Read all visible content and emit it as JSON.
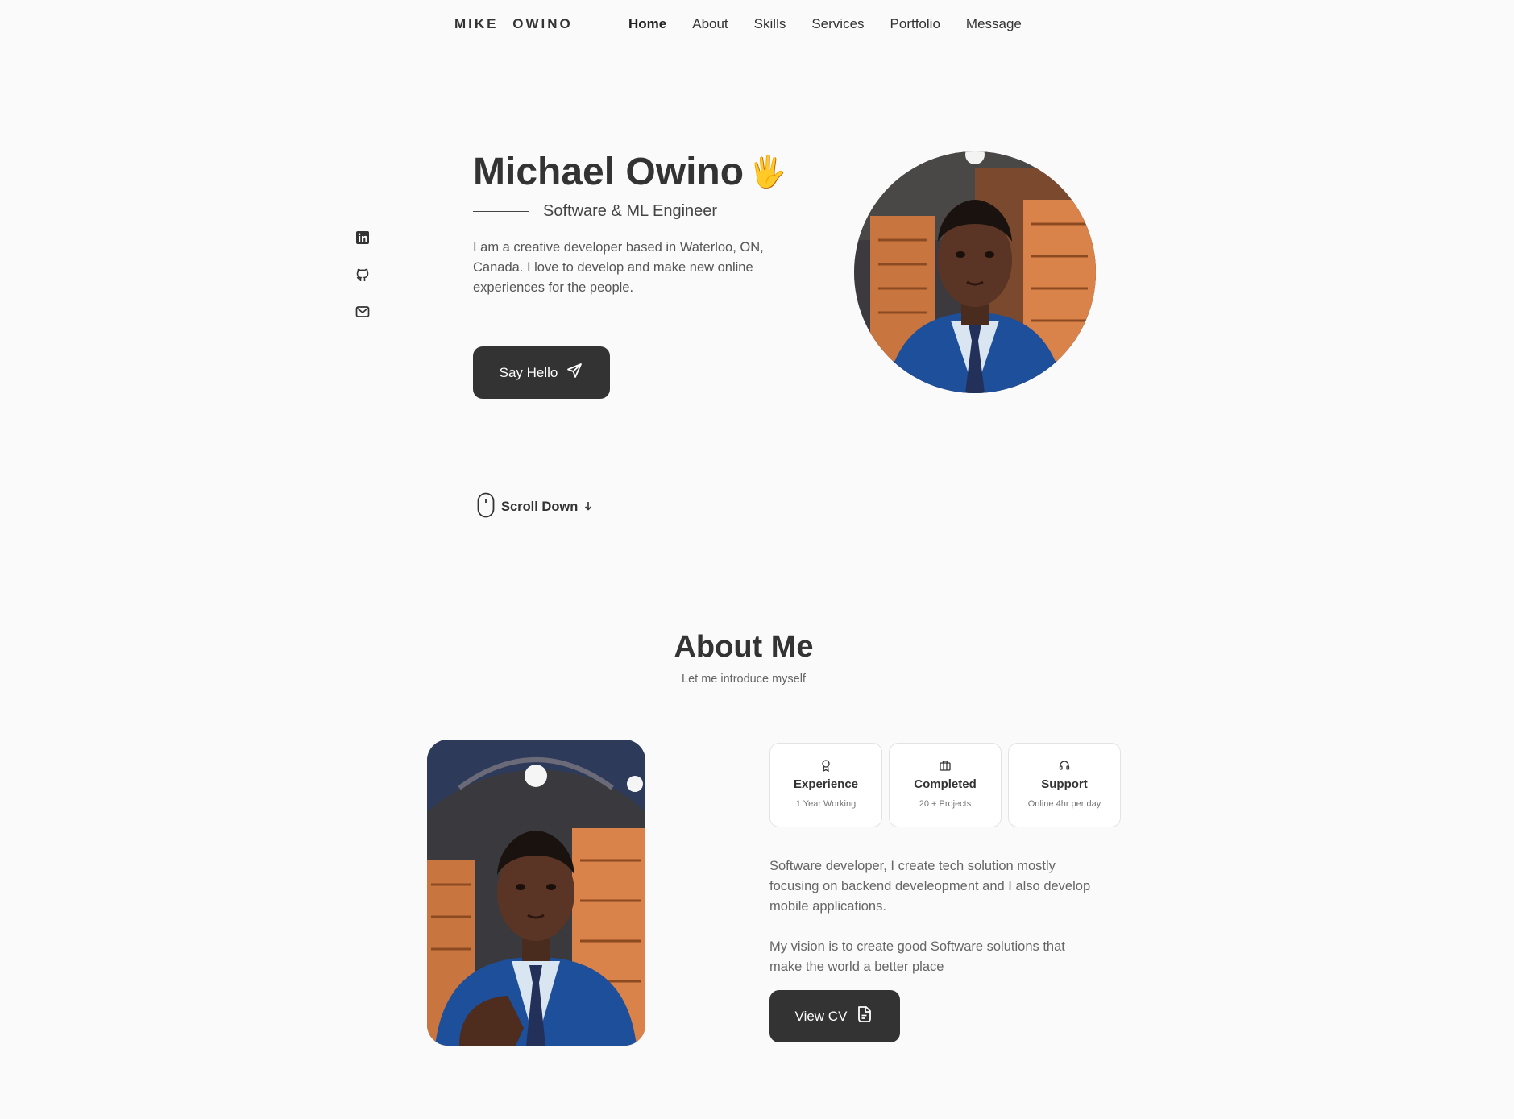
{
  "header": {
    "logo": "MIKE OWINO",
    "nav": [
      "Home",
      "About",
      "Skills",
      "Services",
      "Portfolio",
      "Message"
    ]
  },
  "socials": {
    "icons": [
      "linkedin-icon",
      "github-icon",
      "mail-icon"
    ]
  },
  "hero": {
    "name": "Michael Owino",
    "wave_emoji": "🖐",
    "subtitle": "Software & ML Engineer",
    "description": "I am a creative developer based in Waterloo, ON, Canada. I love to develop and make new online experiences for the people.",
    "button_label": "Say Hello",
    "scroll_label": "Scroll Down"
  },
  "about": {
    "title": "About Me",
    "subtitle": "Let me introduce myself",
    "cards": [
      {
        "title": "Experience",
        "sub": "1 Year Working",
        "icon": "award-icon"
      },
      {
        "title": "Completed",
        "sub": "20 + Projects",
        "icon": "briefcase-icon"
      },
      {
        "title": "Support",
        "sub": "Online 4hr per day",
        "icon": "headset-icon"
      }
    ],
    "paragraph1": "Software developer, I create tech solution mostly focusing on backend develeopment and I also develop mobile applications.",
    "paragraph2": "My vision is to create good Software solutions that make the world a better place",
    "cv_label": "View CV"
  },
  "colors": {
    "background": "#fafafa",
    "text": "#333333",
    "button": "#333333",
    "accent_wave": "#f4c430"
  }
}
